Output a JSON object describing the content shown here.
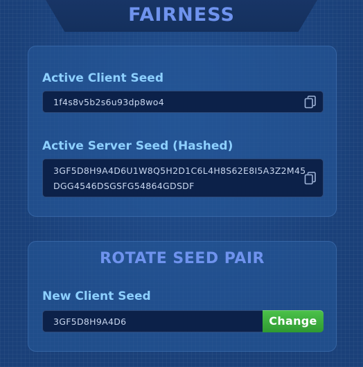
{
  "header": {
    "title": "FAIRNESS"
  },
  "active_seeds": {
    "client_label": "Active Client Seed",
    "client_value": "1f4s8v5b2s6u93dp8wo4",
    "server_label": "Active Server Seed (Hashed)",
    "server_value_line1": "3GF5D8H9A4D6U1W8Q5H2D1C6L4H8S62E8I5A3Z2M45",
    "server_value_line2": "DGG4546DSGSFG54864GDSDF",
    "copy_icon": "copy-icon"
  },
  "rotate": {
    "title": "ROTATE SEED PAIR",
    "new_client_label": "New Client Seed",
    "new_client_value": "3GF5D8H9A4D6",
    "change_label": "Change"
  },
  "colors": {
    "background": "#1a4079",
    "title": "#6f93ee",
    "label": "#8dd0ff",
    "field_bg": "#0c2149",
    "button_green": "#3aad3b"
  }
}
